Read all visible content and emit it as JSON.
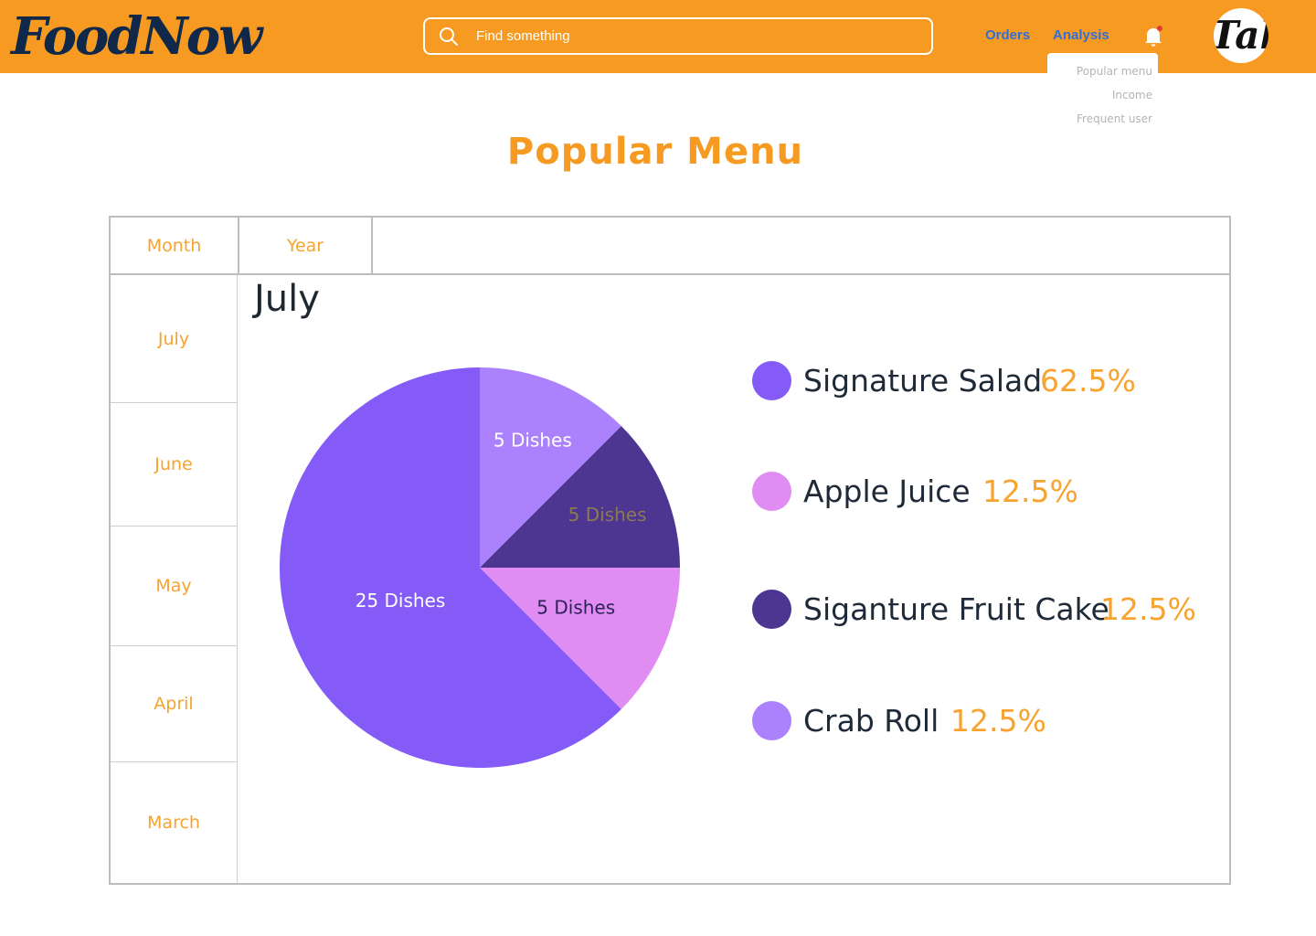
{
  "app": {
    "logo_text": "FoodNow"
  },
  "search": {
    "placeholder": "Find something"
  },
  "nav": {
    "orders": "Orders",
    "analysis": "Analysis"
  },
  "avatar": {
    "text": "Tal"
  },
  "analysis_menu": {
    "items": [
      "Popular menu",
      "Income",
      "Frequent user"
    ]
  },
  "page_title": "Popular Menu",
  "tabs": {
    "month": "Month",
    "year": "Year"
  },
  "months": [
    "July",
    "June",
    "May",
    "April",
    "March"
  ],
  "selected_month": "July",
  "colors": {
    "brand_orange": "#F79A22",
    "nav_blue": "#2F6FD6",
    "signature_salad": "#845BF6",
    "apple_juice": "#E18CF2",
    "signature_fruit_cake": "#4D3592",
    "crab_roll": "#AC81FD"
  },
  "chart_data": {
    "type": "pie",
    "slices": [
      {
        "name": "Signature Salad",
        "dishes": 25,
        "label": "25 Dishes",
        "percent_label": "62.5%",
        "color": "#845BF6"
      },
      {
        "name": "Apple Juice",
        "dishes": 5,
        "label": "5 Dishes",
        "percent_label": "12.5%",
        "color": "#E18CF2"
      },
      {
        "name": "Siganture Fruit Cake",
        "dishes": 5,
        "label": "5 Dishes",
        "percent_label": "12.5%",
        "color": "#4D3592"
      },
      {
        "name": "Crab Roll",
        "dishes": 5,
        "label": "5 Dishes",
        "percent_label": "12.5%",
        "color": "#AC81FD"
      }
    ],
    "legend": "right"
  }
}
